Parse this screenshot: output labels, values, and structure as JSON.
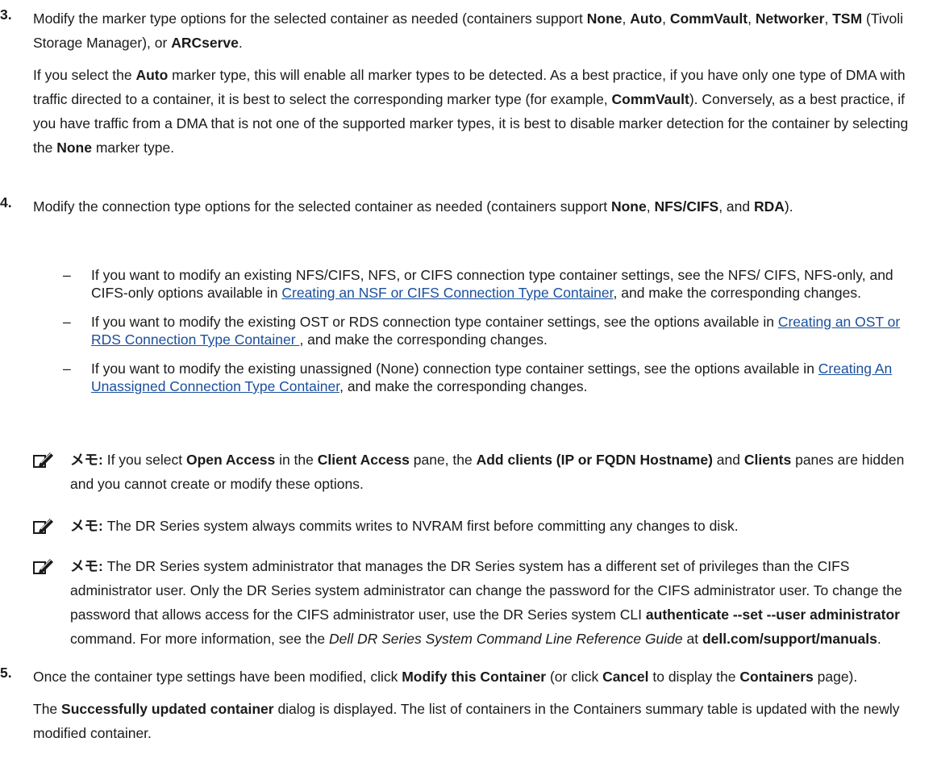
{
  "step3": {
    "num": "3.",
    "p1": [
      {
        "t": "Modify the marker type options for the selected container as needed (containers support "
      },
      {
        "t": "None",
        "b": true
      },
      {
        "t": ", "
      },
      {
        "t": "Auto",
        "b": true
      },
      {
        "t": ", "
      },
      {
        "t": "CommVault",
        "b": true
      },
      {
        "t": ", "
      },
      {
        "t": "Networker",
        "b": true
      },
      {
        "t": ", "
      },
      {
        "t": "TSM",
        "b": true
      },
      {
        "t": " (Tivoli Storage Manager), or "
      },
      {
        "t": "ARCserve",
        "b": true
      },
      {
        "t": "."
      }
    ],
    "p2": [
      {
        "t": "If you select the "
      },
      {
        "t": "Auto",
        "b": true
      },
      {
        "t": " marker type, this will enable all marker types to be detected. As a best practice, if you have only one type of DMA with traffic directed to a container, it is best to select the corresponding marker type (for example, "
      },
      {
        "t": "CommVault",
        "b": true
      },
      {
        "t": "). Conversely, as a best practice, if you have traffic from a DMA that is not one of the supported marker types, it is best to disable marker detection for the container by selecting the "
      },
      {
        "t": "None",
        "b": true
      },
      {
        "t": " marker type."
      }
    ]
  },
  "step4": {
    "num": "4.",
    "p1": [
      {
        "t": "Modify the connection type options for the selected container as needed (containers support "
      },
      {
        "t": "None",
        "b": true
      },
      {
        "t": ", "
      },
      {
        "t": "NFS/CIFS",
        "b": true
      },
      {
        "t": ", and "
      },
      {
        "t": "RDA",
        "b": true
      },
      {
        "t": ")."
      }
    ],
    "bullets": [
      {
        "dash": "–",
        "runs": [
          {
            "t": "If you want to modify an existing NFS/CIFS, NFS, or CIFS connection type container settings, see the NFS/ CIFS, NFS-only, and CIFS-only options available in "
          },
          {
            "t": "Creating an NSF or CIFS Connection Type Container",
            "link": true
          },
          {
            "t": ", and make the corresponding changes."
          }
        ]
      },
      {
        "dash": "–",
        "runs": [
          {
            "t": "If you want to modify the existing OST or RDS connection type container settings, see the options available in "
          },
          {
            "t": "Creating an OST or RDS Connection Type Container ",
            "link": true
          },
          {
            "t": ", and make the corresponding changes."
          }
        ]
      },
      {
        "dash": "–",
        "runs": [
          {
            "t": "If you want to modify the existing unassigned (None) connection type container settings, see the options available in "
          },
          {
            "t": "Creating An Unassigned Connection Type Container",
            "link": true
          },
          {
            "t": ", and make the corresponding changes."
          }
        ]
      }
    ]
  },
  "notes": [
    {
      "icon": "pencil-note-icon",
      "runs": [
        {
          "t": "メモ: ",
          "b": true
        },
        {
          "t": "If you select "
        },
        {
          "t": "Open Access",
          "b": true
        },
        {
          "t": " in the "
        },
        {
          "t": "Client Access",
          "b": true
        },
        {
          "t": " pane, the "
        },
        {
          "t": "Add clients (IP or FQDN Hostname)",
          "b": true
        },
        {
          "t": " and "
        },
        {
          "t": "Clients",
          "b": true
        },
        {
          "t": " panes are hidden and you cannot create or modify these options."
        }
      ]
    },
    {
      "icon": "pencil-note-icon",
      "runs": [
        {
          "t": "メモ: ",
          "b": true
        },
        {
          "t": "The DR Series system always commits writes to NVRAM first before committing any changes to disk."
        }
      ]
    },
    {
      "icon": "pencil-note-icon",
      "runs": [
        {
          "t": "メモ: ",
          "b": true
        },
        {
          "t": "The DR Series system administrator that manages the DR Series system has a different set of privileges than the CIFS administrator user. Only the DR Series system administrator can change the password for the CIFS administrator user. To change the password that allows access for the CIFS administrator user, use the DR Series system CLI "
        },
        {
          "t": "authenticate --set --user administrator",
          "b": true
        },
        {
          "t": " command. For more information, see the "
        },
        {
          "t": "Dell DR Series System Command Line Reference Guide",
          "i": true
        },
        {
          "t": " at "
        },
        {
          "t": "dell.com/support/manuals",
          "b": true
        },
        {
          "t": "."
        }
      ]
    }
  ],
  "step5": {
    "num": "5.",
    "p1": [
      {
        "t": "Once the container type settings have been modified, click "
      },
      {
        "t": "Modify this Container",
        "b": true
      },
      {
        "t": " (or click "
      },
      {
        "t": "Cancel",
        "b": true
      },
      {
        "t": " to display the "
      },
      {
        "t": "Containers",
        "b": true
      },
      {
        "t": " page)."
      }
    ],
    "p2": [
      {
        "t": "The "
      },
      {
        "t": "Successfully updated container",
        "b": true
      },
      {
        "t": " dialog is displayed. The list of containers in the Containers summary table is updated with the newly modified container."
      }
    ]
  }
}
